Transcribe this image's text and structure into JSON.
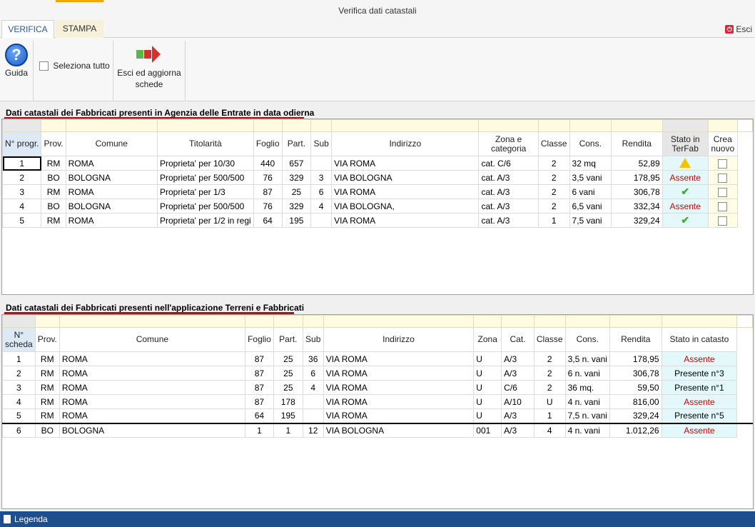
{
  "window": {
    "title": "Verifica dati catastali"
  },
  "tabs": [
    {
      "label": "VERIFICA"
    },
    {
      "label": "STAMPA"
    }
  ],
  "exit_top": {
    "label": "Esci"
  },
  "ribbon": {
    "help_label": "Guida",
    "select_all_label": "Seleziona tutto",
    "exit_update_label_1": "Esci ed aggiorna",
    "exit_update_label_2": "schede"
  },
  "section1": {
    "title": "Dati catastali dei Fabbricati presenti in Agenzia delle Entrate in data odierna",
    "headers": [
      "N° progr.",
      "Prov.",
      "Comune",
      "Titolarità",
      "Foglio",
      "Part.",
      "Sub",
      "Indirizzo",
      "Zona e categoria",
      "Classe",
      "Cons.",
      "Rendita",
      "Stato in TerFab",
      "Crea nuovo"
    ],
    "rows": [
      {
        "n": "1",
        "prov": "RM",
        "comune": "ROMA",
        "tit": "Proprieta' per 10/30",
        "foglio": "440",
        "part": "657",
        "sub": "",
        "ind": "VIA ROMA",
        "zona": "cat. C/6",
        "classe": "2",
        "cons": "32 mq",
        "rendita": "52,89",
        "stato": "warning-icon"
      },
      {
        "n": "2",
        "prov": "BO",
        "comune": "BOLOGNA",
        "tit": "Proprieta' per 500/500",
        "foglio": "76",
        "part": "329",
        "sub": "3",
        "ind": "VIA BOLOGNA",
        "zona": "cat. A/3",
        "classe": "2",
        "cons": "3,5 vani",
        "rendita": "178,95",
        "stato": "Assente"
      },
      {
        "n": "3",
        "prov": "RM",
        "comune": "ROMA",
        "tit": "Proprieta' per 1/3",
        "foglio": "87",
        "part": "25",
        "sub": "6",
        "ind": "VIA ROMA",
        "zona": "cat. A/3",
        "classe": "2",
        "cons": "6 vani",
        "rendita": "306,78",
        "stato": "check-icon"
      },
      {
        "n": "4",
        "prov": "BO",
        "comune": "BOLOGNA",
        "tit": "Proprieta' per 500/500",
        "foglio": "76",
        "part": "329",
        "sub": "4",
        "ind": "VIA BOLOGNA,",
        "zona": "cat. A/3",
        "classe": "2",
        "cons": "6,5 vani",
        "rendita": "332,34",
        "stato": "Assente"
      },
      {
        "n": "5",
        "prov": "RM",
        "comune": "ROMA",
        "tit": "Proprieta' per 1/2 in regi",
        "foglio": "64",
        "part": "195",
        "sub": "",
        "ind": "VIA ROMA",
        "zona": "cat. A/3",
        "classe": "1",
        "cons": "7,5 vani",
        "rendita": "329,24",
        "stato": "check-icon"
      }
    ]
  },
  "section2": {
    "title": "Dati catastali dei Fabbricati presenti nell'applicazione Terreni e Fabbricati",
    "headers": [
      "N° scheda",
      "Prov.",
      "Comune",
      "Foglio",
      "Part.",
      "Sub",
      "Indirizzo",
      "Zona",
      "Cat.",
      "Classe",
      "Cons.",
      "Rendita",
      "Stato in catasto"
    ],
    "rows": [
      {
        "n": "1",
        "prov": "RM",
        "comune": "ROMA",
        "foglio": "87",
        "part": "25",
        "sub": "36",
        "ind": "VIA ROMA",
        "zona": "U",
        "cat": "A/3",
        "classe": "2",
        "cons": "3,5 n. vani",
        "rendita": "178,95",
        "stato": "Assente"
      },
      {
        "n": "2",
        "prov": "RM",
        "comune": "ROMA",
        "foglio": "87",
        "part": "25",
        "sub": "6",
        "ind": "VIA ROMA",
        "zona": "U",
        "cat": "A/3",
        "classe": "2",
        "cons": "6 n. vani",
        "rendita": "306,78",
        "stato": "Presente n°3"
      },
      {
        "n": "3",
        "prov": "RM",
        "comune": "ROMA",
        "foglio": "87",
        "part": "25",
        "sub": "4",
        "ind": "VIA ROMA",
        "zona": "U",
        "cat": "C/6",
        "classe": "2",
        "cons": "36 mq.",
        "rendita": "59,50",
        "stato": "Presente n°1"
      },
      {
        "n": "4",
        "prov": "RM",
        "comune": "ROMA",
        "foglio": "87",
        "part": "178",
        "sub": "",
        "ind": "VIA ROMA",
        "zona": "U",
        "cat": "A/10",
        "classe": "U",
        "cons": "4 n. vani",
        "rendita": "816,00",
        "stato": "Assente"
      },
      {
        "n": "5",
        "prov": "RM",
        "comune": "ROMA",
        "foglio": "64",
        "part": "195",
        "sub": "",
        "ind": "VIA ROMA",
        "zona": "U",
        "cat": "A/3",
        "classe": "1",
        "cons": "7,5 n. vani",
        "rendita": "329,24",
        "stato": "Presente n°5"
      },
      {
        "n": "6",
        "prov": "BO",
        "comune": "BOLOGNA",
        "foglio": "1",
        "part": "1",
        "sub": "12",
        "ind": "VIA BOLOGNA",
        "zona": "001",
        "cat": "A/3",
        "classe": "4",
        "cons": "4 n. vani",
        "rendita": "1.012,26",
        "stato": "Assente"
      }
    ]
  },
  "footer": {
    "label": "Legenda"
  },
  "colors": {
    "accent": "#2b579a",
    "footer": "#1f4e8c",
    "assente": "#d10000",
    "check": "#3fae2a",
    "warning": "#f5c400",
    "section_underline": "#d00000"
  }
}
